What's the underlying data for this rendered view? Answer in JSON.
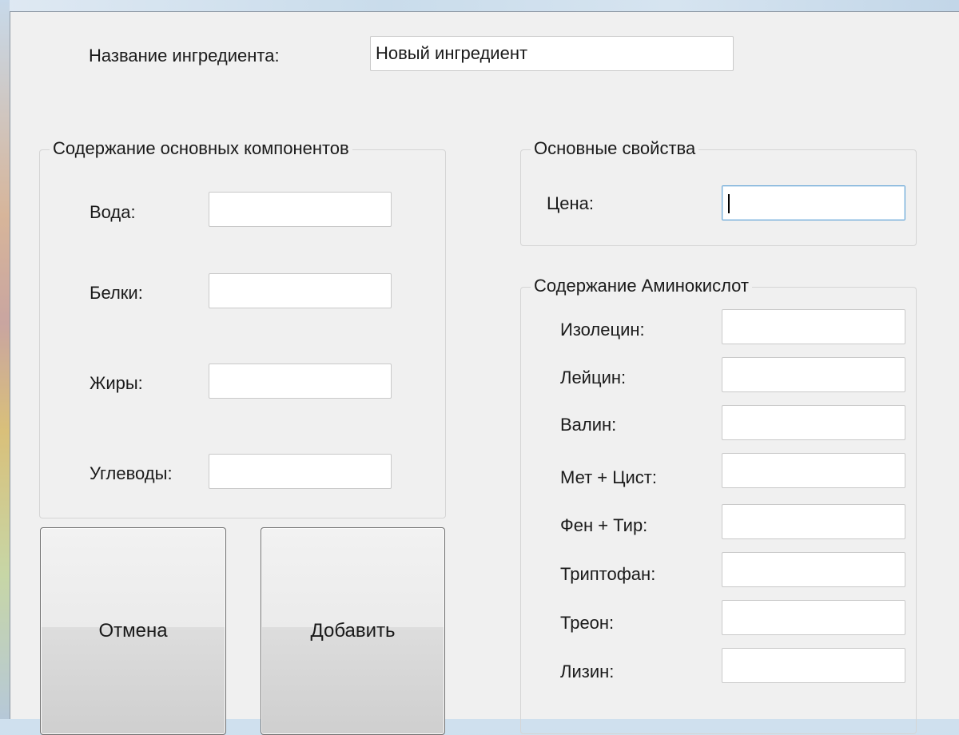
{
  "form": {
    "name_label": "Название ингредиента:",
    "name_value": "Новый ингредиент"
  },
  "main_components": {
    "title": "Содержание основных компонентов",
    "fields": [
      {
        "label": "Вода:",
        "value": ""
      },
      {
        "label": "Белки:",
        "value": ""
      },
      {
        "label": "Жиры:",
        "value": ""
      },
      {
        "label": "Углеводы:",
        "value": ""
      }
    ]
  },
  "properties": {
    "title": "Основные свойства",
    "price_label": "Цена:",
    "price_value": ""
  },
  "amino": {
    "title": "Содержание Аминокислот",
    "fields": [
      {
        "label": "Изолецин:",
        "value": ""
      },
      {
        "label": "Лейцин:",
        "value": ""
      },
      {
        "label": "Валин:",
        "value": ""
      },
      {
        "label": "Мет + Цист:",
        "value": ""
      },
      {
        "label": "Фен + Тир:",
        "value": ""
      },
      {
        "label": "Триптофан:",
        "value": ""
      },
      {
        "label": "Треон:",
        "value": ""
      },
      {
        "label": "Лизин:",
        "value": ""
      }
    ]
  },
  "buttons": {
    "cancel": "Отмена",
    "add": "Добавить"
  },
  "colors": {
    "window_bg": "#f0f0f0",
    "focus_border": "#6aa8d8"
  }
}
